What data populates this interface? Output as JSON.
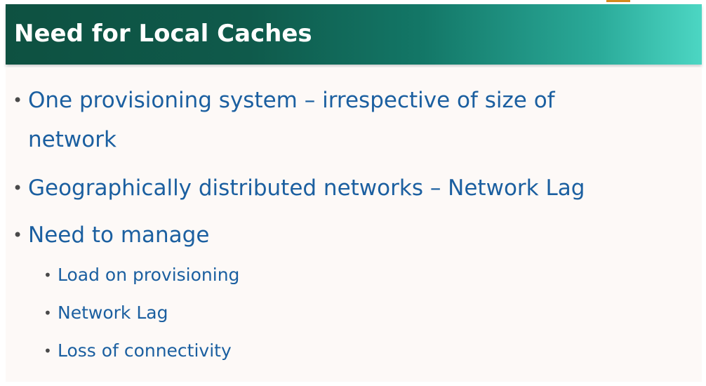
{
  "slide": {
    "title": "Need for Local Caches",
    "bullets": [
      {
        "line1": "One provisioning system – irrespective of size of",
        "line2": "network"
      },
      {
        "text": "Geographically distributed networks – Network Lag"
      },
      {
        "text": "Need to manage",
        "sub_bullets": [
          "Load on provisioning",
          "Network Lag",
          "Loss of connectivity"
        ]
      }
    ],
    "bullet_symbol": "•"
  },
  "colors": {
    "title_bar_dark": "#0e5141",
    "title_bar_light": "#4cd6c3",
    "title_text": "#ffffff",
    "body_text": "#1b5fa0",
    "content_background": "#fdf9f7"
  }
}
